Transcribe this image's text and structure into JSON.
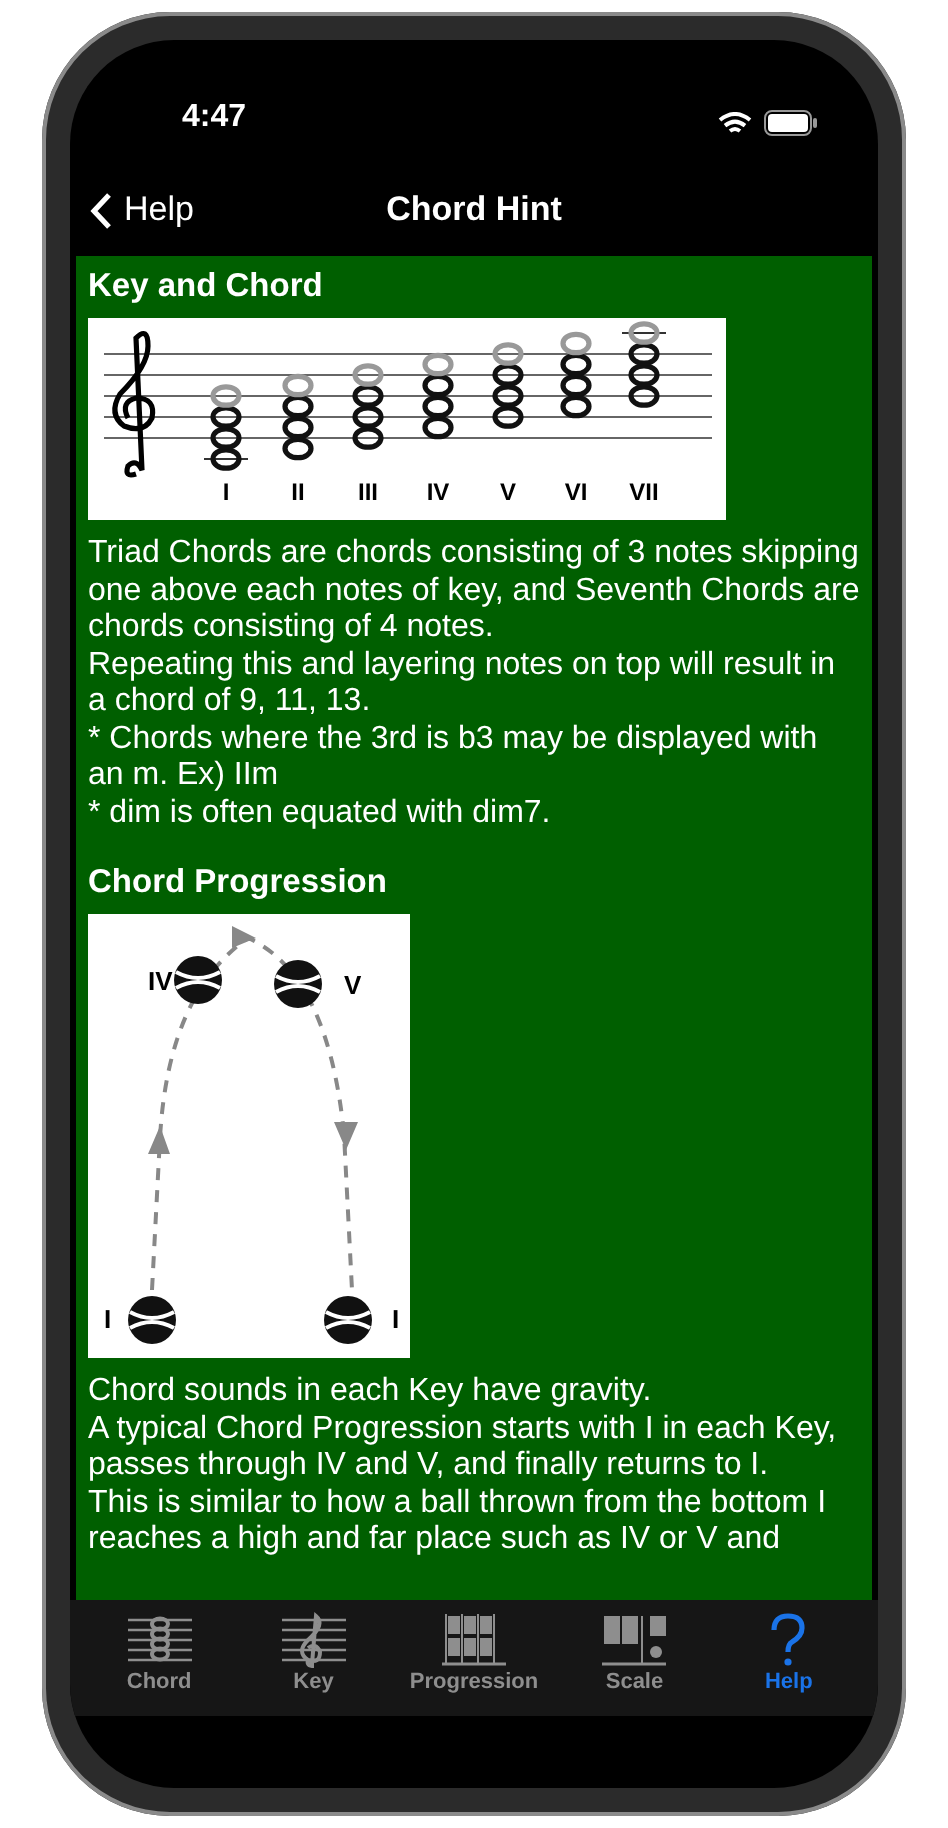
{
  "status_bar": {
    "time": "4:47"
  },
  "nav": {
    "back_label": "Help",
    "title": "Chord Hint"
  },
  "sections": [
    {
      "heading": "Key and Chord",
      "figure": {
        "kind": "staff",
        "labels": [
          "I",
          "II",
          "III",
          "IV",
          "V",
          "VI",
          "VII"
        ]
      },
      "paragraphs": [
        "Triad Chords are chords consisting of 3 notes skipping one above each notes of key, and Seventh Chords are chords consisting of 4 notes.",
        "Repeating this and layering notes on top will result in a chord of 9, 11, 13.",
        "* Chords where the 3rd is b3 may be displayed with an m. Ex) IIm",
        "* dim is often equated with dim7."
      ]
    },
    {
      "heading": "Chord Progression",
      "figure": {
        "kind": "progression",
        "labels": [
          "IV",
          "V",
          "I",
          "I"
        ]
      },
      "paragraphs": [
        "Chord sounds in each Key have gravity.",
        "A typical Chord Progression starts with I in each Key, passes through IV and V, and finally returns to I.",
        "This is similar to how a ball thrown from the bottom I reaches a high and far place such as IV or V and"
      ]
    }
  ],
  "tabs": [
    {
      "kind": "chord",
      "label": "Chord",
      "selected": false
    },
    {
      "kind": "key",
      "label": "Key",
      "selected": false
    },
    {
      "kind": "progression",
      "label": "Progression",
      "selected": false
    },
    {
      "kind": "scale",
      "label": "Scale",
      "selected": false
    },
    {
      "kind": "help",
      "label": "Help",
      "selected": true
    }
  ]
}
